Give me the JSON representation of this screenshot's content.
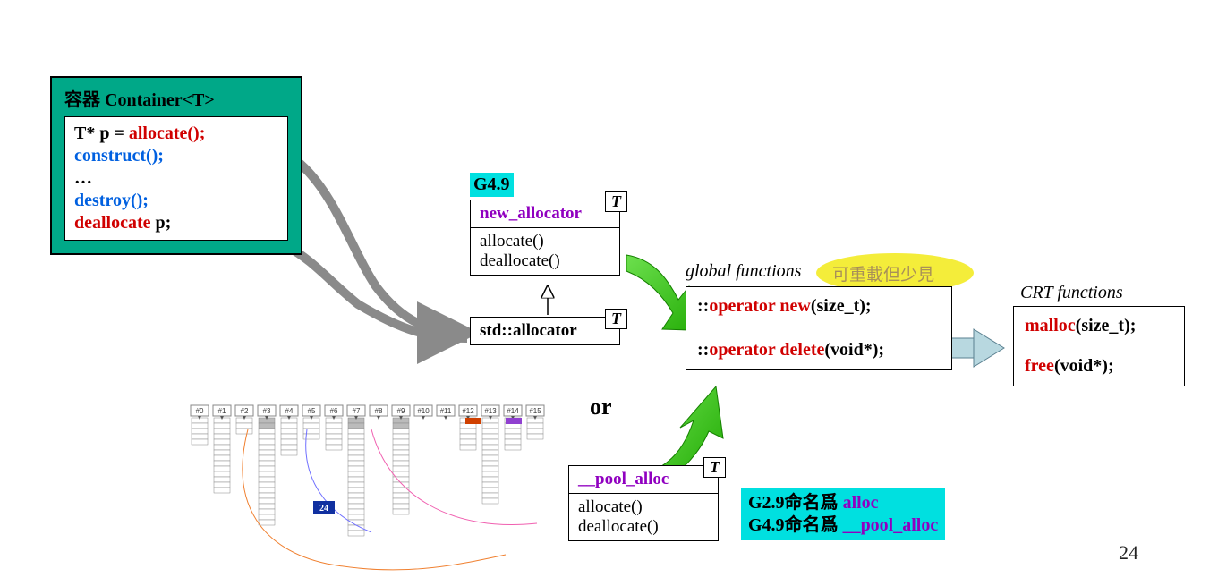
{
  "container": {
    "title_zh": "容器 ",
    "title_en": "Container<T>",
    "code": {
      "l1a": "T* p = ",
      "l1b": "allocate();",
      "l2": "construct();",
      "l3": "…",
      "l4": "destroy();",
      "l5a": "deallocate",
      "l5b": " p;"
    }
  },
  "g49": "G4.9",
  "new_allocator": {
    "name": "new_allocator",
    "m1": "allocate()",
    "m2": "deallocate()",
    "T": "T"
  },
  "std_allocator": {
    "name": "std::allocator",
    "T": "T"
  },
  "or_label": "or",
  "pool_alloc": {
    "name": "__pool_alloc",
    "m1": "allocate()",
    "m2": "deallocate()",
    "T": "T"
  },
  "global_functions": {
    "label": "global functions",
    "highlight_zh": "可重載但少見",
    "l1a": "::",
    "l1b": "operator new",
    "l1c": "(size_t);",
    "l2a": "::",
    "l2b": "operator delete",
    "l2c": "(void*);"
  },
  "crt": {
    "label": "CRT functions",
    "l1a": "malloc",
    "l1b": "(size_t);",
    "l2a": "free",
    "l2b": "(void*);"
  },
  "naming": {
    "g29a": "G2.9命名爲 ",
    "g29b": "alloc",
    "g49a": "G4.9命名爲 ",
    "g49b": "__pool_alloc"
  },
  "freelist": {
    "headers": [
      "#0",
      "#1",
      "#2",
      "#3",
      "#4",
      "#5",
      "#6",
      "#7",
      "#8",
      "#9",
      "#10",
      "#11",
      "#12",
      "#13",
      "#14",
      "#15"
    ],
    "badge": "24"
  },
  "page": "24"
}
